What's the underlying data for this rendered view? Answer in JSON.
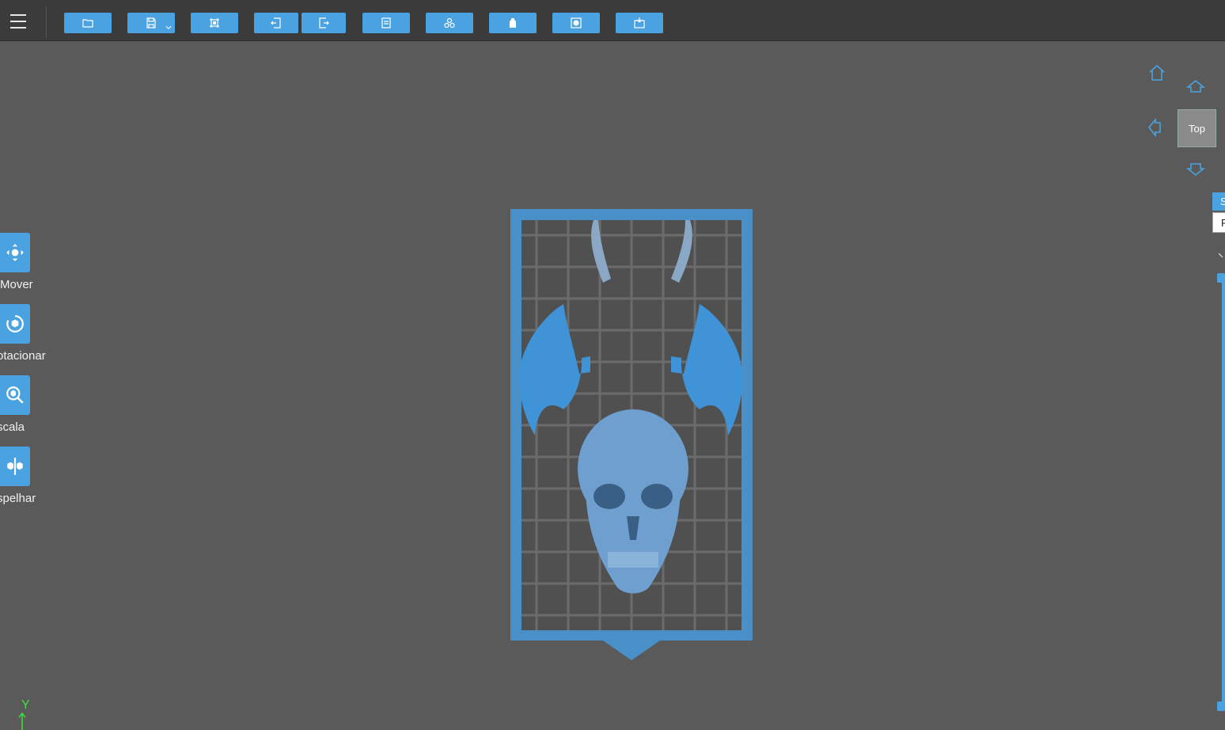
{
  "toolbar": {
    "menu_icon": "hamburger-icon",
    "buttons": [
      {
        "name": "open-file",
        "icon": "folder-icon"
      },
      {
        "name": "save",
        "icon": "save-icon"
      },
      {
        "name": "select-all",
        "icon": "select-frame-icon"
      },
      {
        "name": "undo",
        "icon": "undo-icon"
      },
      {
        "name": "redo",
        "icon": "redo-icon"
      },
      {
        "name": "layout",
        "icon": "layout-icon"
      },
      {
        "name": "arrange",
        "icon": "arrange-icon"
      },
      {
        "name": "support",
        "icon": "bottle-icon"
      },
      {
        "name": "hollow",
        "icon": "hollow-icon"
      },
      {
        "name": "slice",
        "icon": "slice-icon"
      }
    ]
  },
  "left_tools": [
    {
      "label": "Mover",
      "icon": "move-icon"
    },
    {
      "label": "otacionar",
      "icon": "rotate-icon"
    },
    {
      "label": "scala",
      "icon": "scale-icon"
    },
    {
      "label": "spelhar",
      "icon": "mirror-icon"
    }
  ],
  "view_nav": {
    "current_view": "Top",
    "home_icon": "home-icon",
    "up_icon": "arrow-up-icon",
    "left_icon": "arrow-left-icon",
    "down_icon": "arrow-down-icon"
  },
  "side_tabs": [
    "S",
    "R"
  ],
  "axis": {
    "label": "Y"
  },
  "colors": {
    "accent": "#4aa3e0",
    "background": "#5a5a5a",
    "toolbar": "#3b3b3b",
    "model": "#4a9ad8",
    "skull": "#6e9fcf"
  }
}
